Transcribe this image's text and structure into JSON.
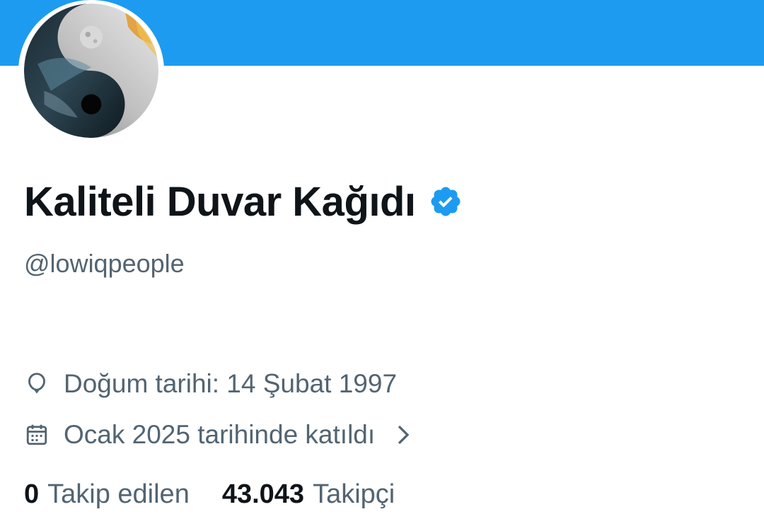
{
  "profile": {
    "display_name": "Kaliteli Duvar Kağıdı",
    "handle": "@lowiqpeople",
    "verified_icon": "verified-badge-icon",
    "banner_color": "#1d9bf0",
    "verified_color": "#1d9bf0"
  },
  "info": {
    "birth": {
      "icon": "balloon-icon",
      "text": "Doğum tarihi: 14 Şubat 1997"
    },
    "joined": {
      "icon": "calendar-icon",
      "text": "Ocak 2025 tarihinde katıldı",
      "chevron": "chevron-right-icon"
    }
  },
  "stats": {
    "following": {
      "count": "0",
      "label": "Takip edilen"
    },
    "followers": {
      "count": "43.043",
      "label": "Takipçi"
    }
  },
  "colors": {
    "primary_text": "#0f1419",
    "secondary_text": "#536471"
  }
}
